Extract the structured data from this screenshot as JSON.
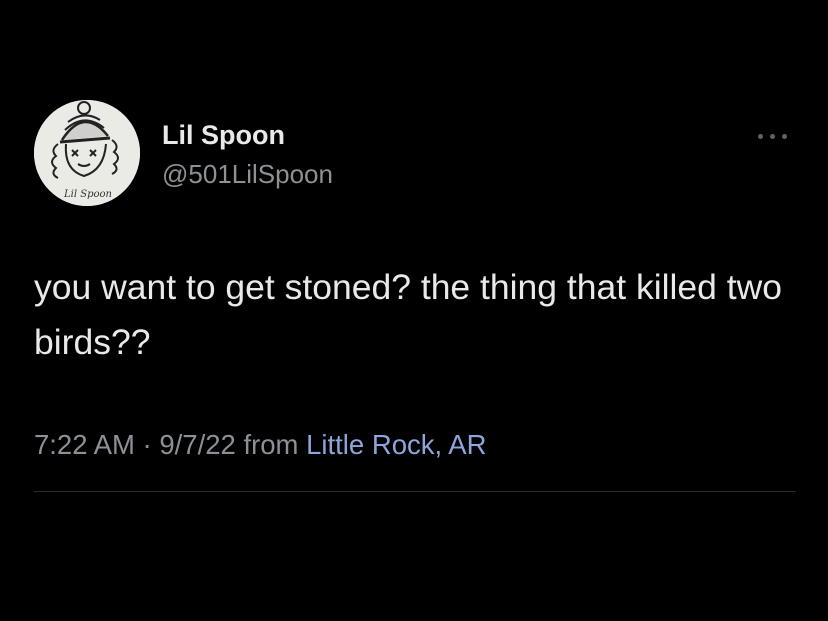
{
  "author": {
    "display_name": "Lil Spoon",
    "handle": "@501LilSpoon",
    "avatar_caption": "Lil Spoon"
  },
  "tweet": {
    "text": "you want to get stoned? the thing that killed two birds??",
    "time": "7:22 AM",
    "separator": "·",
    "date": "9/7/22",
    "from_label": "from",
    "location": "Little Rock, AR"
  },
  "icons": {
    "more": "more-dots-icon"
  },
  "colors": {
    "background": "#000000",
    "primary_text": "#e7e9ea",
    "secondary_text": "#8b9196",
    "link": "#8ea5da"
  }
}
